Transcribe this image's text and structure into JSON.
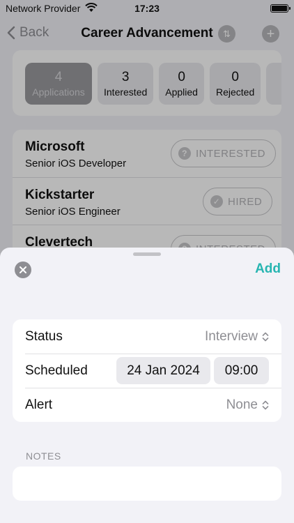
{
  "status_bar": {
    "carrier": "Network Provider",
    "time": "17:23"
  },
  "nav": {
    "back_label": "Back",
    "title": "Career Advancement"
  },
  "stats": [
    {
      "count": "4",
      "label": "Applications"
    },
    {
      "count": "3",
      "label": "Interested"
    },
    {
      "count": "0",
      "label": "Applied"
    },
    {
      "count": "0",
      "label": "Rejected"
    }
  ],
  "jobs": [
    {
      "company": "Microsoft",
      "role": "Senior iOS Developer",
      "status": "INTERESTED",
      "status_icon": "?"
    },
    {
      "company": "Kickstarter",
      "role": "Senior iOS Engineer",
      "status": "HIRED",
      "status_icon": "✓"
    },
    {
      "company": "Clevertech",
      "role": "",
      "status": "INTERESTED",
      "status_icon": "?"
    }
  ],
  "sheet": {
    "add_label": "Add",
    "status": {
      "label": "Status",
      "value": "Interview"
    },
    "scheduled": {
      "label": "Scheduled",
      "date": "24 Jan 2024",
      "time": "09:00"
    },
    "alert": {
      "label": "Alert",
      "value": "None"
    },
    "notes_label": "NOTES",
    "notes_value": ""
  },
  "colors": {
    "accent": "#27b5b1",
    "secondary_text": "#8e8e93",
    "background": "#f2f2f7"
  }
}
